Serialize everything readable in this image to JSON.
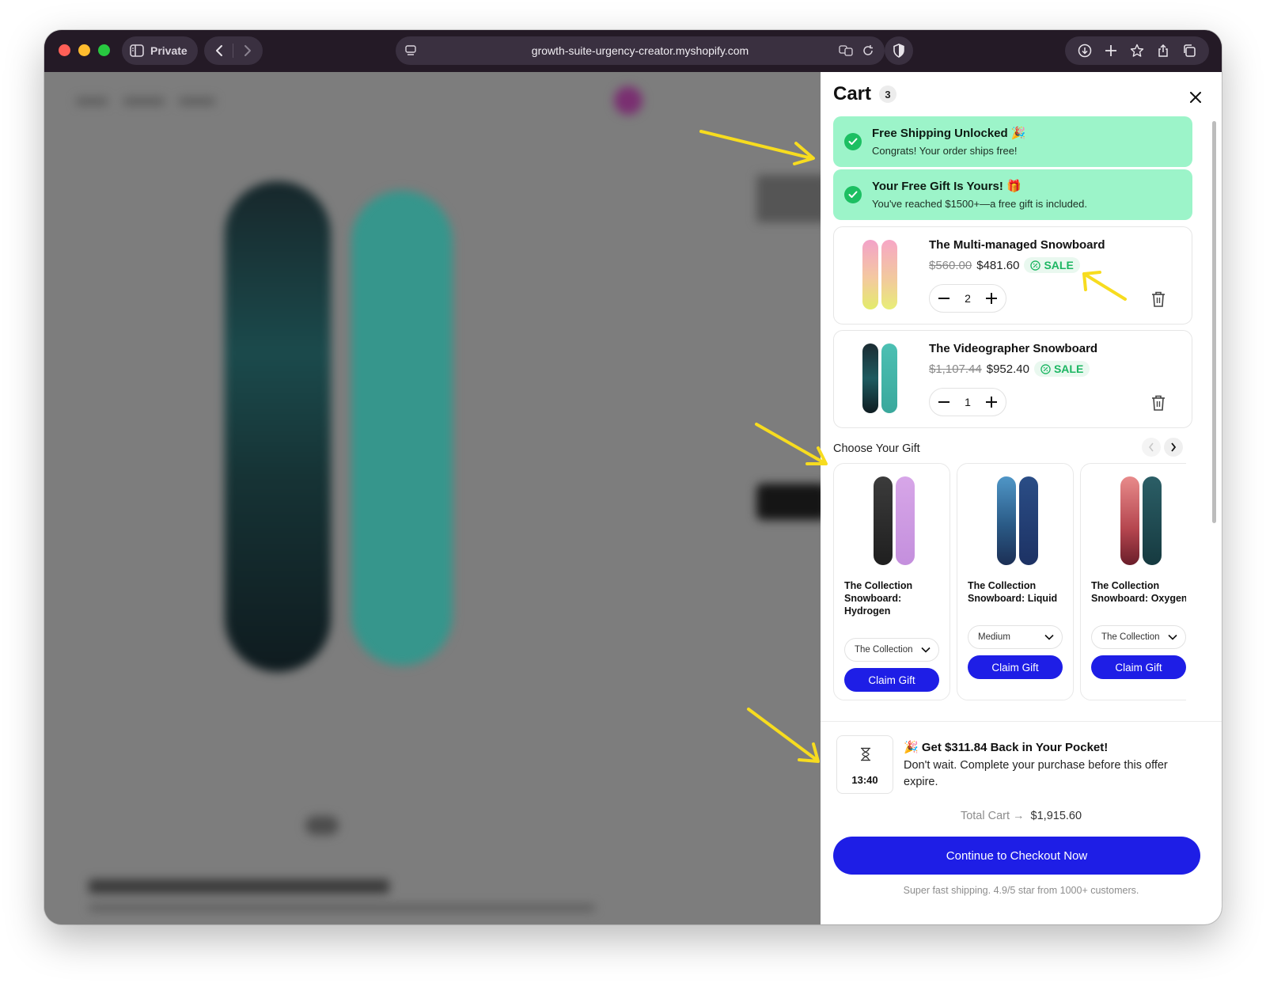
{
  "browser": {
    "private_label": "Private",
    "url": "growth-suite-urgency-creator.myshopify.com"
  },
  "cart": {
    "title": "Cart",
    "count": "3",
    "banners": [
      {
        "title": "Free Shipping Unlocked 🎉",
        "text": "Congrats! Your order ships free!"
      },
      {
        "title": "Your Free Gift Is Yours! 🎁",
        "text": "You've reached $1500+—a free gift is included."
      }
    ],
    "items": [
      {
        "name": "The Multi-managed Snowboard",
        "old_price": "$560.00",
        "price": "$481.60",
        "badge": "SALE",
        "qty": "2"
      },
      {
        "name": "The Videographer Snowboard",
        "old_price": "$1,107.44",
        "price": "$952.40",
        "badge": "SALE",
        "qty": "1"
      }
    ],
    "gift_heading": "Choose Your Gift",
    "gifts": [
      {
        "name": "The Collection Snowboard: Hydrogen",
        "option": "The Collection",
        "button": "Claim Gift"
      },
      {
        "name": "The Collection Snowboard: Liquid",
        "option": "Medium",
        "button": "Claim Gift"
      },
      {
        "name": "The Collection Snowboard: Oxygen",
        "option": "The Collection",
        "button": "Claim Gift"
      }
    ],
    "timer": "13:40",
    "offer_title": "🎉 Get $311.84 Back in Your Pocket!",
    "offer_text": "Don't wait. Complete your purchase before this offer expire.",
    "total_label": "Total Cart →",
    "total_value": "$1,915.60",
    "checkout_label": "Continue to Checkout Now",
    "footer_note": "Super fast shipping. 4.9/5 star from 1000+ customers."
  },
  "colors": {
    "accent": "#1e1ee6",
    "banner_bg": "#9cf4c9",
    "success": "#1cbf62",
    "annotation_arrow": "#f7dc1f"
  }
}
